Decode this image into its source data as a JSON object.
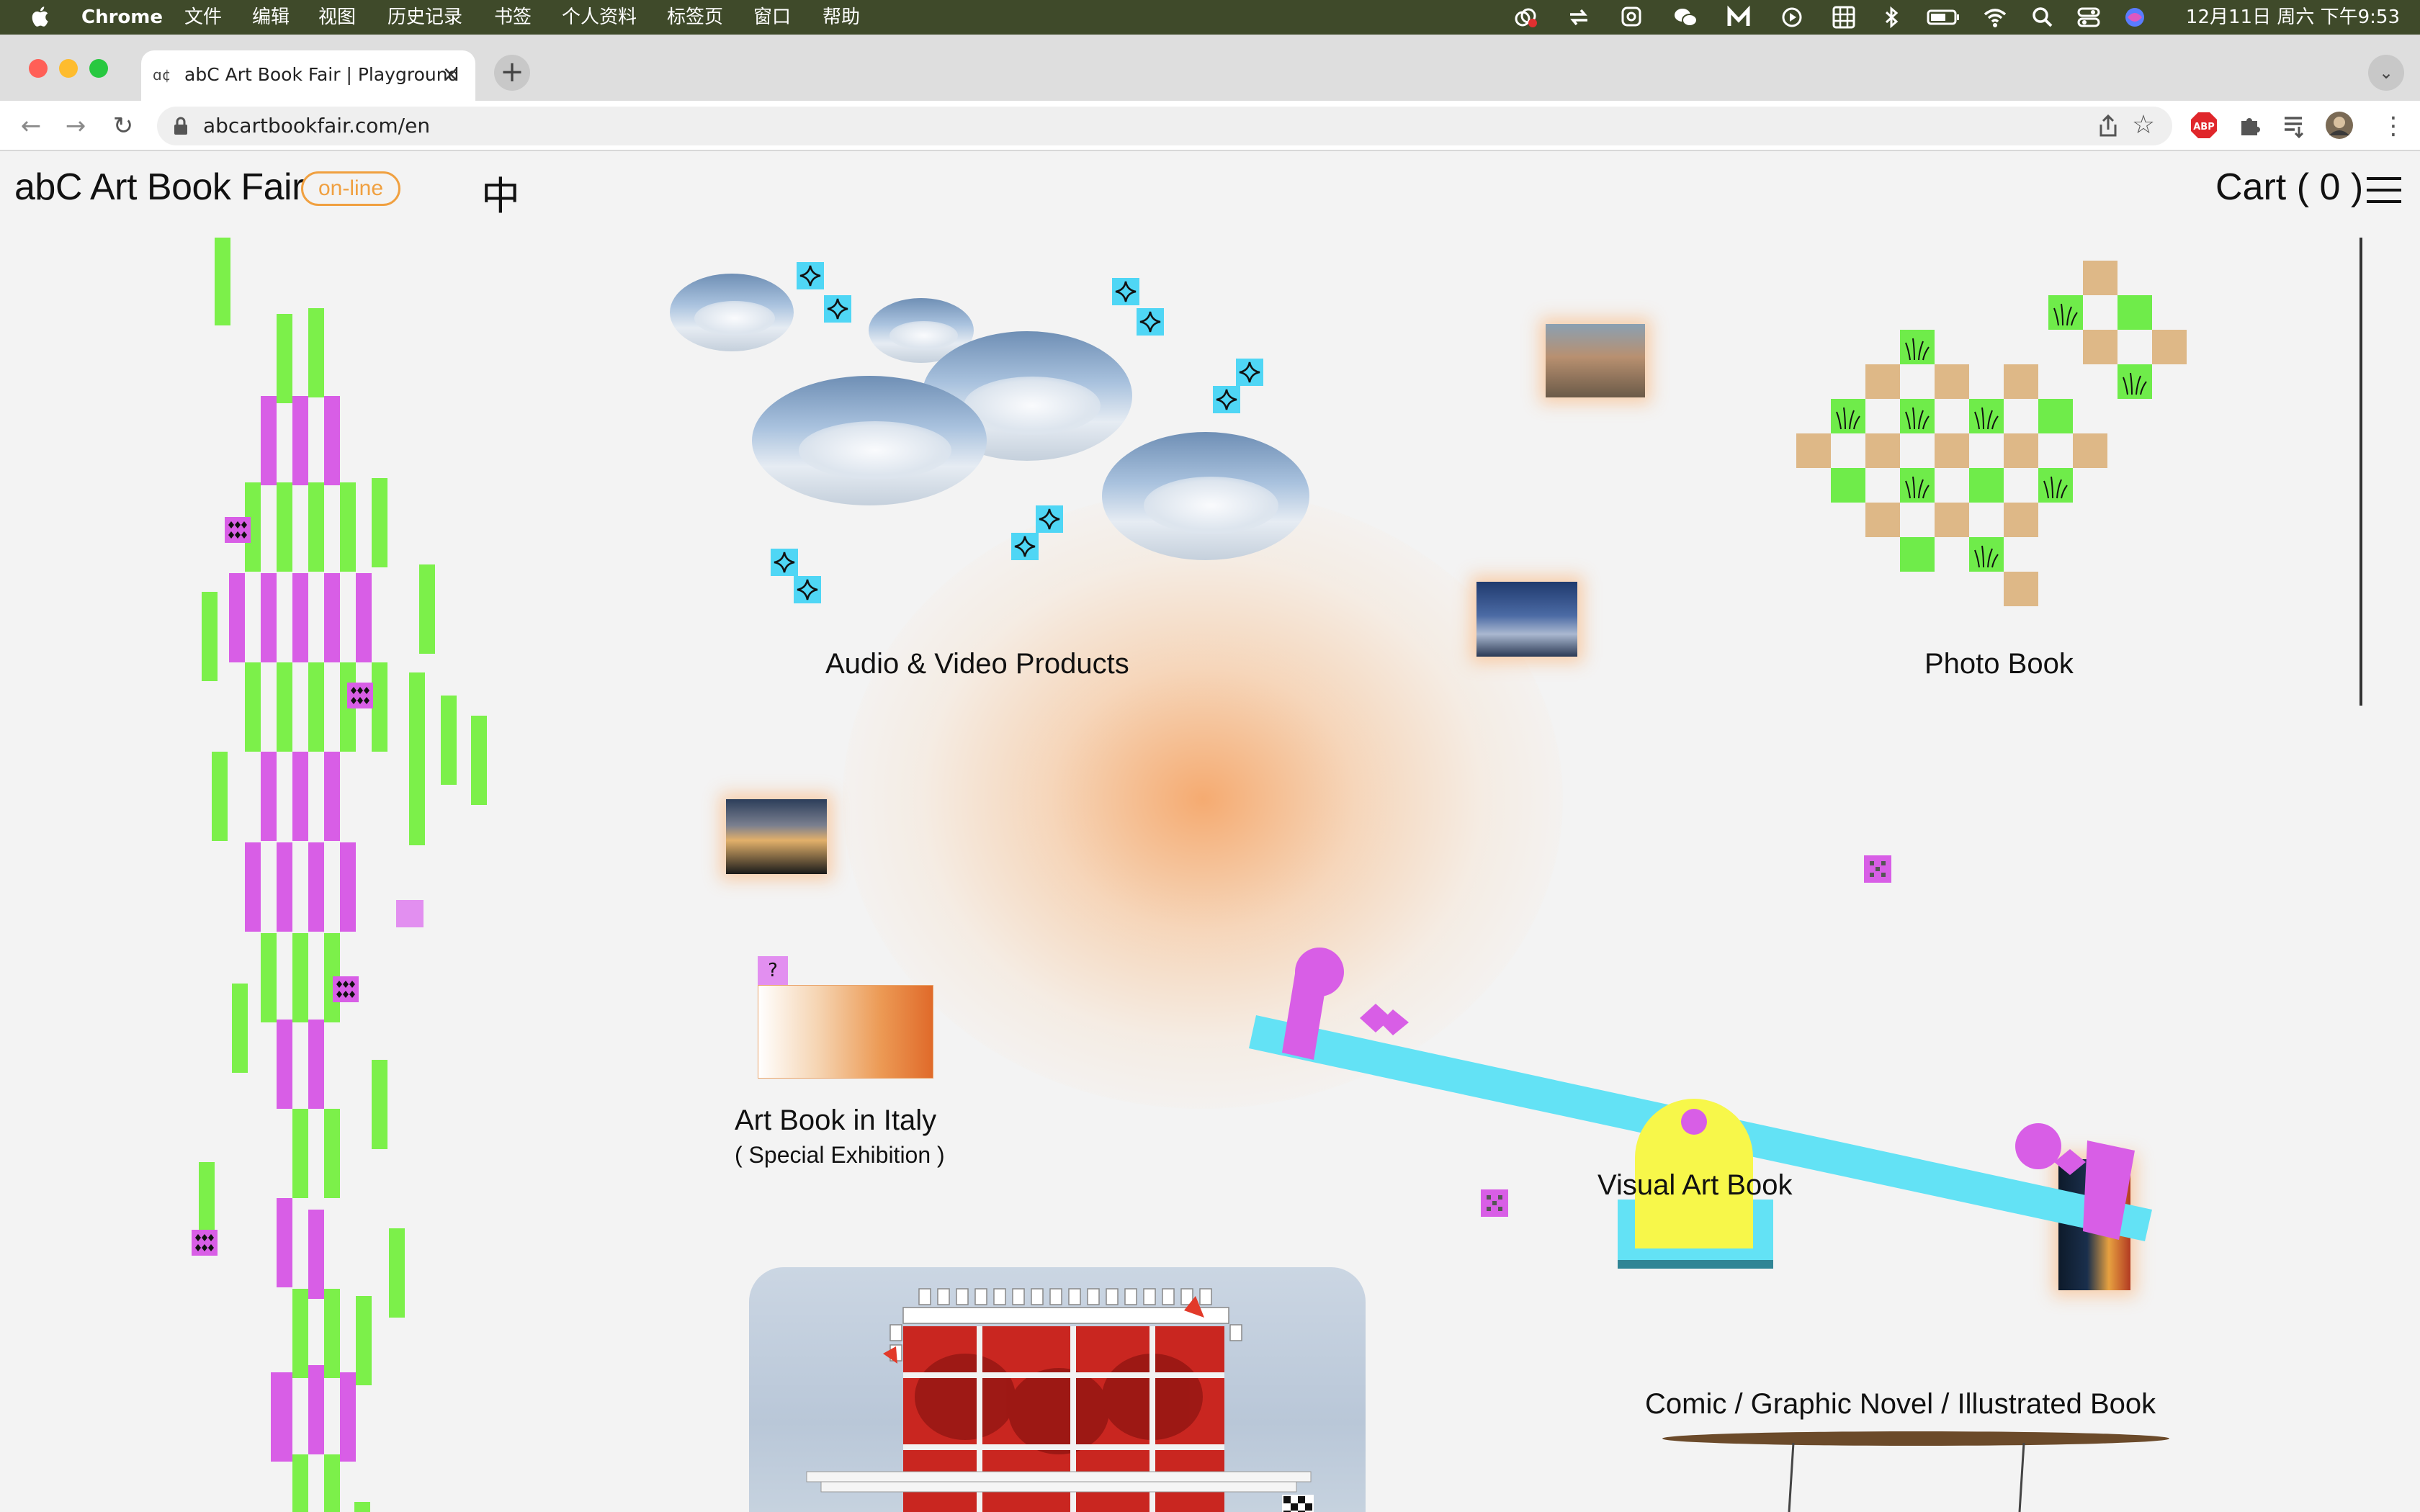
{
  "menubar": {
    "app": "Chrome",
    "items": [
      "文件",
      "编辑",
      "视图",
      "历史记录",
      "书签",
      "个人资料",
      "标签页",
      "窗口",
      "帮助"
    ],
    "clock": "12月11日 周六 下午9:53",
    "status_icons": [
      "creative-cloud-icon",
      "sync-icon",
      "qq-icon",
      "wechat-icon",
      "m-app-icon",
      "play-icon",
      "calendar-grid-icon",
      "bluetooth-icon",
      "battery-icon",
      "wifi-icon",
      "spotlight-search-icon",
      "control-center-icon",
      "siri-icon"
    ]
  },
  "browser": {
    "tab_title": "abC Art Book Fair | Playground",
    "url": "abcartbookfair.com/en"
  },
  "site": {
    "logo": "abC Art Book Fair",
    "badge": "on-line",
    "lang_toggle": "中",
    "cart_label": "Cart",
    "cart_count": "( 0 )",
    "categories": {
      "audio_video": "Audio & Video Products",
      "photo_book": "Photo Book",
      "art_book_italy": "Art Book in Italy",
      "art_book_italy_sub": "( Special Exhibition )",
      "visual_art_book": "Visual Art Book",
      "comic": "Comic / Graphic Novel / Illustrated Book"
    },
    "question_mark": "?"
  },
  "colors": {
    "menubar_bg": "#3f4a2a",
    "accent_orange": "#f0a040",
    "green": "#7cf04a",
    "purple": "#d85ee6",
    "cyan": "#5fe0f5",
    "yellow": "#f7f74a",
    "tan": "#deb887"
  }
}
